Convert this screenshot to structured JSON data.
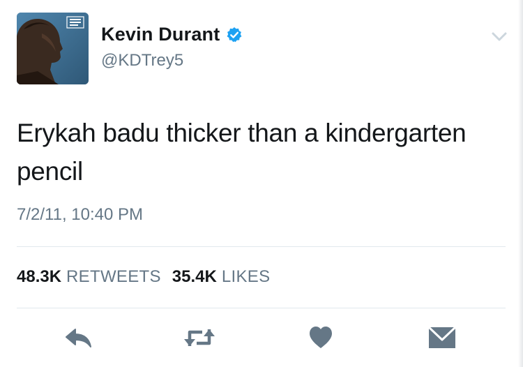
{
  "user": {
    "display_name": "Kevin Durant",
    "handle": "@KDTrey5",
    "verified": true
  },
  "tweet": {
    "text": "Erykah badu thicker than a kindergarten pencil",
    "timestamp": "7/2/11, 10:40 PM"
  },
  "stats": {
    "retweets_count": "48.3K",
    "retweets_label": "RETWEETS",
    "likes_count": "35.4K",
    "likes_label": "LIKES"
  },
  "icons": {
    "verified": "verified-badge-icon",
    "more": "chevron-down-icon",
    "reply": "reply-icon",
    "retweet": "retweet-icon",
    "like": "heart-icon",
    "message": "envelope-icon"
  },
  "colors": {
    "text": "#14171a",
    "secondary": "#657786",
    "verified": "#1da1f2",
    "icon": "#657786",
    "divider": "#e1e8ed"
  }
}
